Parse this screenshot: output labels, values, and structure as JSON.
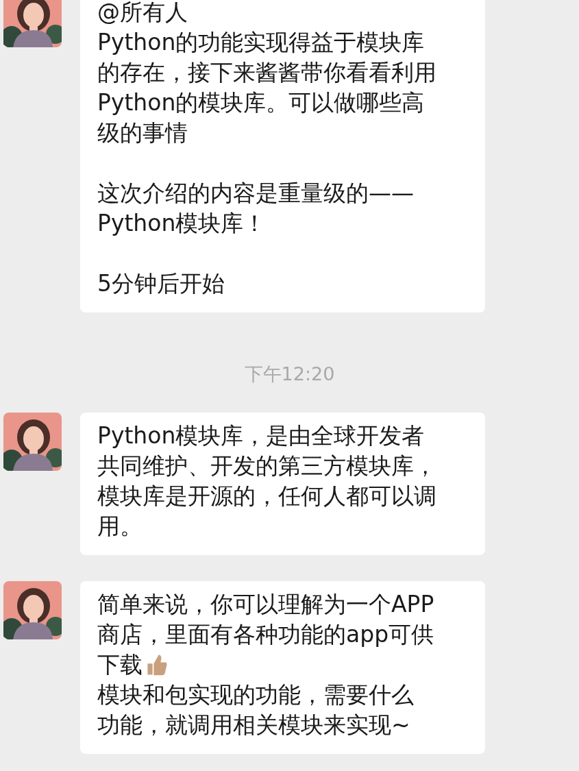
{
  "messages": [
    {
      "paragraphs": [
        {
          "lines": [
            {
              "text": "@所有人",
              "emoji": false
            },
            {
              "text": "Python的功能实现得益于模块库",
              "emoji": false
            },
            {
              "text": "的存在，接下来酱酱带你看看利用",
              "emoji": false
            },
            {
              "text": "Python的模块库。可以做哪些高",
              "emoji": false
            },
            {
              "text": "级的事情",
              "emoji": false
            }
          ]
        },
        {
          "lines": [
            {
              "text": "这次介绍的内容是重量级的——",
              "emoji": false
            },
            {
              "text": "Python模块库！",
              "emoji": false
            }
          ]
        },
        {
          "lines": [
            {
              "text": "5分钟后开始",
              "emoji": false
            }
          ]
        }
      ]
    },
    {
      "timestamp": "下午12:20",
      "paragraphs": [
        {
          "lines": [
            {
              "text": "Python模块库，是由全球开发者",
              "emoji": false
            },
            {
              "text": "共同维护、开发的第三方模块库，",
              "emoji": false
            },
            {
              "text": "模块库是开源的，任何人都可以调",
              "emoji": false
            },
            {
              "text": "用。",
              "emoji": false
            }
          ]
        }
      ]
    },
    {
      "paragraphs": [
        {
          "lines": [
            {
              "text": "简单来说，你可以理解为一个APP",
              "emoji": false
            },
            {
              "text": "商店，里面有各种功能的app可供",
              "emoji": false
            },
            {
              "text": "下载",
              "emoji": true
            },
            {
              "text": "模块和包实现的功能，需要什么",
              "emoji": false
            },
            {
              "text": "功能，就调用相关模块来实现~",
              "emoji": false
            }
          ]
        }
      ]
    }
  ]
}
